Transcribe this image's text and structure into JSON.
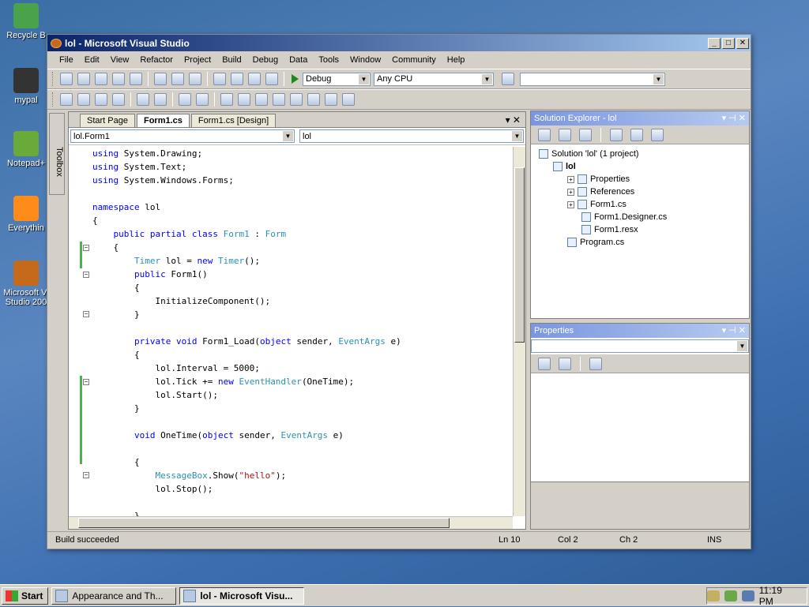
{
  "desktop": {
    "icons": [
      {
        "label": "Recycle B",
        "color": "#4aa34a"
      },
      {
        "label": "mypal",
        "color": "#333333"
      },
      {
        "label": "Notepad+",
        "color": "#6aaa3a"
      },
      {
        "label": "Everythin",
        "color": "#ff8c1a"
      },
      {
        "label": "Microsoft Vi\nStudio 200",
        "color": "#c46a1a"
      }
    ]
  },
  "window": {
    "title": "lol - Microsoft Visual Studio",
    "min_label": "_",
    "max_label": "□",
    "close_label": "✕"
  },
  "menu": [
    "File",
    "Edit",
    "View",
    "Refactor",
    "Project",
    "Build",
    "Debug",
    "Data",
    "Tools",
    "Window",
    "Community",
    "Help"
  ],
  "toolbar": {
    "config": "Debug",
    "platform": "Any CPU",
    "find": ""
  },
  "toolbox": {
    "label": "Toolbox"
  },
  "editor": {
    "tabs": [
      {
        "label": "Start Page",
        "active": false
      },
      {
        "label": "Form1.cs",
        "active": true
      },
      {
        "label": "Form1.cs [Design]",
        "active": false
      }
    ],
    "class_combo": "lol.Form1",
    "member_combo": "lol"
  },
  "solution_explorer": {
    "title": "Solution Explorer - lol",
    "items": [
      {
        "label": "Solution 'lol' (1 project)",
        "indent": 0,
        "bold": false
      },
      {
        "label": "lol",
        "indent": 1,
        "bold": true
      },
      {
        "label": "Properties",
        "indent": 2,
        "bold": false
      },
      {
        "label": "References",
        "indent": 2,
        "bold": false
      },
      {
        "label": "Form1.cs",
        "indent": 2,
        "bold": false
      },
      {
        "label": "Form1.Designer.cs",
        "indent": 3,
        "bold": false
      },
      {
        "label": "Form1.resx",
        "indent": 3,
        "bold": false
      },
      {
        "label": "Program.cs",
        "indent": 2,
        "bold": false
      }
    ]
  },
  "properties": {
    "title": "Properties"
  },
  "status": {
    "message": "Build succeeded",
    "line": "Ln 10",
    "col": "Col 2",
    "ch": "Ch 2",
    "mode": "INS"
  },
  "taskbar": {
    "start": "Start",
    "tasks": [
      {
        "label": "Appearance and Th...",
        "active": false
      },
      {
        "label": "lol - Microsoft Visu...",
        "active": true
      }
    ],
    "clock": "11:19 PM"
  }
}
